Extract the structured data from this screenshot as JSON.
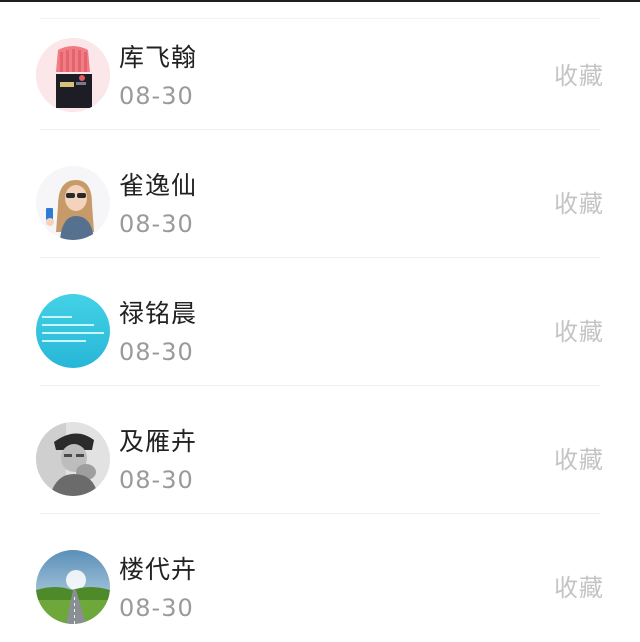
{
  "contacts": [
    {
      "name": "库飞翰",
      "date": "08-30",
      "action": "收藏",
      "avatar_icon": "pink-sweater-avatar-icon"
    },
    {
      "name": "雀逸仙",
      "date": "08-30",
      "action": "收藏",
      "avatar_icon": "girl-sunglasses-avatar-icon"
    },
    {
      "name": "禄铭晨",
      "date": "08-30",
      "action": "收藏",
      "avatar_icon": "cyan-text-avatar-icon"
    },
    {
      "name": "及雁卉",
      "date": "08-30",
      "action": "收藏",
      "avatar_icon": "grayscale-portrait-avatar-icon"
    },
    {
      "name": "楼代卉",
      "date": "08-30",
      "action": "收藏",
      "avatar_icon": "road-landscape-avatar-icon"
    }
  ],
  "colors": {
    "name_text": "#222222",
    "date_text": "#9a9a9a",
    "action_text": "#c4c4c4",
    "separator": "#efefef"
  }
}
